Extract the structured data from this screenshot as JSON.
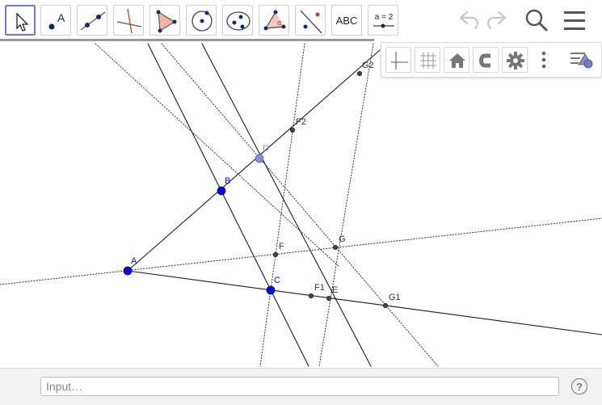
{
  "toolbar": {
    "tools": [
      {
        "name": "move-tool",
        "active": true
      },
      {
        "name": "point-tool",
        "label": "A"
      },
      {
        "name": "line-tool"
      },
      {
        "name": "perpendicular-line-tool"
      },
      {
        "name": "polygon-tool"
      },
      {
        "name": "circle-center-point-tool"
      },
      {
        "name": "conic-tool"
      },
      {
        "name": "angle-tool",
        "label": "α"
      },
      {
        "name": "reflect-tool"
      },
      {
        "name": "text-tool",
        "label": "ABC"
      },
      {
        "name": "slider-tool",
        "label": "a = 2"
      }
    ],
    "undo_icon": "undo-icon",
    "redo_icon": "redo-icon",
    "search_icon": "search-icon",
    "menu_icon": "hamburger-menu-icon"
  },
  "stylebar": {
    "buttons": [
      "axes-toggle-icon",
      "grid-toggle-icon",
      "home-icon",
      "magnet-icon",
      "gear-icon",
      "more-vertical-icon",
      "style-panel-icon"
    ]
  },
  "graphics": {
    "points": {
      "A": "A",
      "B": "B",
      "C": "C",
      "D": "D",
      "E": "E",
      "F": "F",
      "G": "G",
      "F1": "F1",
      "F2": "F2",
      "G1": "G1",
      "G2": "G2"
    }
  },
  "input": {
    "placeholder": "Input…"
  },
  "help_label": "?",
  "colors": {
    "free_point": "#0000ff",
    "dependent_point": "#444444",
    "light_point": "#7f8fd8",
    "line": "#1a1a1a",
    "active_border": "#6b7ad6"
  }
}
